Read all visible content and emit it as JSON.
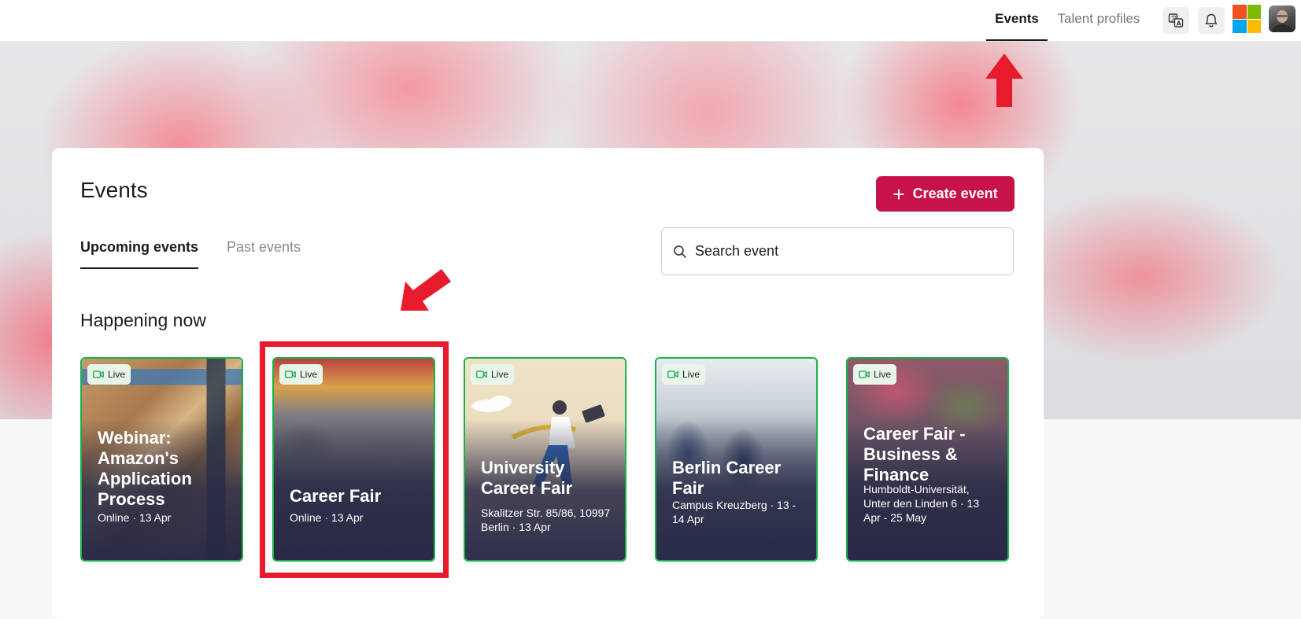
{
  "topbar": {
    "tabs": [
      {
        "label": "Events",
        "active": true
      },
      {
        "label": "Talent profiles",
        "active": false
      }
    ],
    "icons": [
      "translate-icon",
      "bell-icon",
      "microsoft-logo",
      "user-avatar"
    ]
  },
  "main": {
    "title": "Events",
    "create_button": "Create event",
    "tabs": [
      {
        "label": "Upcoming events",
        "active": true
      },
      {
        "label": "Past events",
        "active": false
      }
    ],
    "search_placeholder": "Search event",
    "section_title": "Happening now",
    "events": [
      {
        "badge": "Live",
        "title": "Webinar: Amazon's Application Process",
        "info": "Online · 13 Apr"
      },
      {
        "badge": "Live",
        "title": "Career Fair",
        "info": "Online · 13 Apr"
      },
      {
        "badge": "Live",
        "title": "University Career Fair",
        "info": "Skalitzer Str. 85/86, 10997 Berlin · 13 Apr"
      },
      {
        "badge": "Live",
        "title": "Berlin Career Fair",
        "info": "Campus Kreuzberg · 13 - 14 Apr"
      },
      {
        "badge": "Live",
        "title": "Career Fair - Business & Finance",
        "info": "Humboldt-Universität, Unter den Linden 6 · 13 Apr - 25 May"
      }
    ]
  },
  "colors": {
    "accent": "#c8124a",
    "live_border": "#17b34a",
    "annotation": "#e71b2b"
  }
}
